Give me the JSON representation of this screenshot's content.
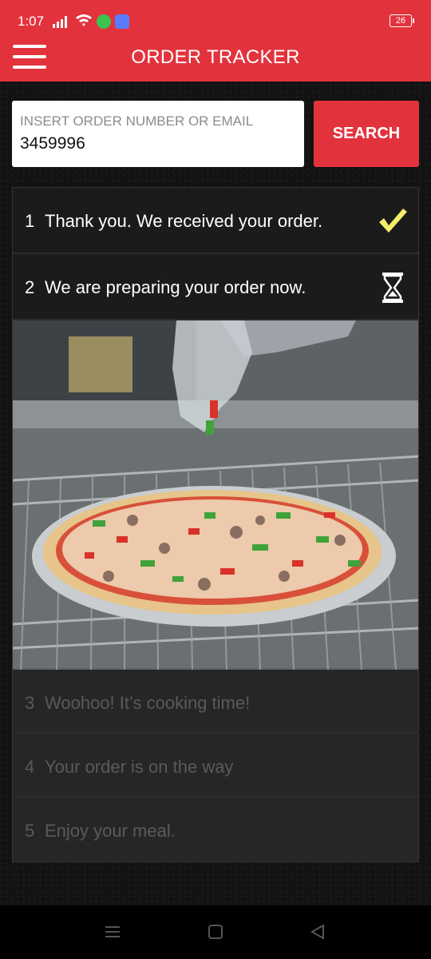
{
  "status_bar": {
    "time": "1:07",
    "battery": "26"
  },
  "header": {
    "title": "ORDER TRACKER",
    "background": "#e2333d"
  },
  "search": {
    "placeholder": "INSERT ORDER NUMBER OR EMAIL",
    "value": "3459996",
    "button_label": "SEARCH"
  },
  "steps": [
    {
      "number": "1",
      "text": "Thank you. We received your order.",
      "state": "done",
      "icon": "check-icon"
    },
    {
      "number": "2",
      "text": "We are preparing your order now.",
      "state": "current",
      "icon": "hourglass-icon"
    },
    {
      "number": "3",
      "text": "Woohoo! It’s cooking time!",
      "state": "pending"
    },
    {
      "number": "4",
      "text": "Your order is on the way",
      "state": "pending"
    },
    {
      "number": "5",
      "text": "Enjoy your meal.",
      "state": "pending"
    }
  ],
  "colors": {
    "accent": "#e2333d",
    "check": "#f4ec6a"
  }
}
